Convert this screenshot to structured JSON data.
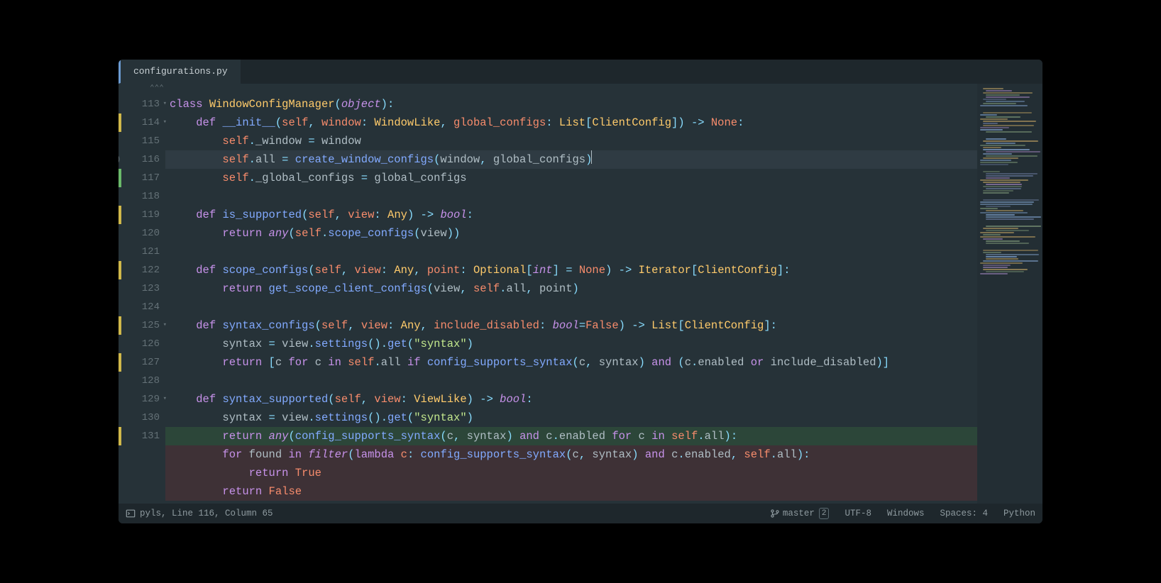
{
  "tab": {
    "filename": "configurations.py"
  },
  "gutter_dots": "⌃⌃⌃",
  "lines": [
    {
      "n": 113,
      "fold": true,
      "mod": "",
      "indent": 0,
      "tokens": [
        [
          "kw",
          "class "
        ],
        [
          "type",
          "WindowConfigManager"
        ],
        [
          "punc",
          "("
        ],
        [
          "kw-i",
          "object"
        ],
        [
          "punc",
          ")"
        ],
        [
          "op",
          ":"
        ]
      ]
    },
    {
      "n": 114,
      "fold": true,
      "mod": "yellow",
      "indent": 1,
      "tokens": [
        [
          "kw",
          "def "
        ],
        [
          "def",
          "__init__"
        ],
        [
          "punc",
          "("
        ],
        [
          "param",
          "self"
        ],
        [
          "punc",
          ", "
        ],
        [
          "param",
          "window"
        ],
        [
          "op",
          ": "
        ],
        [
          "type",
          "WindowLike"
        ],
        [
          "punc",
          ", "
        ],
        [
          "param",
          "global_configs"
        ],
        [
          "op",
          ": "
        ],
        [
          "type",
          "List"
        ],
        [
          "punc",
          "["
        ],
        [
          "type",
          "ClientConfig"
        ],
        [
          "punc",
          "]"
        ],
        [
          "punc",
          ") "
        ],
        [
          "op",
          "-> "
        ],
        [
          "const",
          "None"
        ],
        [
          "op",
          ":"
        ]
      ]
    },
    {
      "n": 115,
      "fold": false,
      "mod": "",
      "indent": 2,
      "tokens": [
        [
          "param",
          "self"
        ],
        [
          "op",
          "."
        ],
        [
          "attr",
          "_window"
        ],
        [
          "op",
          " = "
        ],
        [
          "name",
          "window"
        ]
      ]
    },
    {
      "n": 116,
      "fold": false,
      "mod": "",
      "indent": 2,
      "hl": true,
      "paren": true,
      "cursor": true,
      "tokens": [
        [
          "param",
          "self"
        ],
        [
          "op",
          "."
        ],
        [
          "attr",
          "all"
        ],
        [
          "op",
          " = "
        ],
        [
          "call",
          "create_window_configs"
        ],
        [
          "punc",
          "("
        ],
        [
          "name",
          "window"
        ],
        [
          "punc",
          ", "
        ],
        [
          "name",
          "global_configs"
        ],
        [
          "punc",
          ")"
        ]
      ]
    },
    {
      "n": 117,
      "fold": false,
      "mod": "green",
      "indent": 2,
      "tokens": [
        [
          "param",
          "self"
        ],
        [
          "op",
          "."
        ],
        [
          "attr",
          "_global_configs"
        ],
        [
          "op",
          " = "
        ],
        [
          "name",
          "global_configs"
        ]
      ]
    },
    {
      "n": 118,
      "fold": false,
      "mod": "",
      "indent": 0,
      "tokens": []
    },
    {
      "n": 119,
      "fold": false,
      "mod": "yellow",
      "indent": 1,
      "tokens": [
        [
          "kw",
          "def "
        ],
        [
          "def",
          "is_supported"
        ],
        [
          "punc",
          "("
        ],
        [
          "param",
          "self"
        ],
        [
          "punc",
          ", "
        ],
        [
          "param",
          "view"
        ],
        [
          "op",
          ": "
        ],
        [
          "type",
          "Any"
        ],
        [
          "punc",
          ") "
        ],
        [
          "op",
          "-> "
        ],
        [
          "kw-i",
          "bool"
        ],
        [
          "op",
          ":"
        ]
      ]
    },
    {
      "n": 120,
      "fold": false,
      "mod": "",
      "indent": 2,
      "tokens": [
        [
          "kw",
          "return "
        ],
        [
          "kw-i",
          "any"
        ],
        [
          "punc",
          "("
        ],
        [
          "param",
          "self"
        ],
        [
          "op",
          "."
        ],
        [
          "call",
          "scope_configs"
        ],
        [
          "punc",
          "("
        ],
        [
          "name",
          "view"
        ],
        [
          "punc",
          "))"
        ]
      ]
    },
    {
      "n": 121,
      "fold": false,
      "mod": "",
      "indent": 0,
      "tokens": []
    },
    {
      "n": 122,
      "fold": false,
      "mod": "yellow",
      "indent": 1,
      "tokens": [
        [
          "kw",
          "def "
        ],
        [
          "def",
          "scope_configs"
        ],
        [
          "punc",
          "("
        ],
        [
          "param",
          "self"
        ],
        [
          "punc",
          ", "
        ],
        [
          "param",
          "view"
        ],
        [
          "op",
          ": "
        ],
        [
          "type",
          "Any"
        ],
        [
          "punc",
          ", "
        ],
        [
          "param",
          "point"
        ],
        [
          "op",
          ": "
        ],
        [
          "type",
          "Optional"
        ],
        [
          "punc",
          "["
        ],
        [
          "kw-i",
          "int"
        ],
        [
          "punc",
          "]"
        ],
        [
          "op",
          " = "
        ],
        [
          "const",
          "None"
        ],
        [
          "punc",
          ") "
        ],
        [
          "op",
          "-> "
        ],
        [
          "type",
          "Iterator"
        ],
        [
          "punc",
          "["
        ],
        [
          "type",
          "ClientConfig"
        ],
        [
          "punc",
          "]"
        ],
        [
          "op",
          ":"
        ]
      ]
    },
    {
      "n": 123,
      "fold": false,
      "mod": "",
      "indent": 2,
      "tokens": [
        [
          "kw",
          "return "
        ],
        [
          "call",
          "get_scope_client_configs"
        ],
        [
          "punc",
          "("
        ],
        [
          "name",
          "view"
        ],
        [
          "punc",
          ", "
        ],
        [
          "param",
          "self"
        ],
        [
          "op",
          "."
        ],
        [
          "attr",
          "all"
        ],
        [
          "punc",
          ", "
        ],
        [
          "name",
          "point"
        ],
        [
          "punc",
          ")"
        ]
      ]
    },
    {
      "n": 124,
      "fold": false,
      "mod": "",
      "indent": 0,
      "tokens": []
    },
    {
      "n": 125,
      "fold": true,
      "mod": "yellow",
      "indent": 1,
      "tokens": [
        [
          "kw",
          "def "
        ],
        [
          "def",
          "syntax_configs"
        ],
        [
          "punc",
          "("
        ],
        [
          "param",
          "self"
        ],
        [
          "punc",
          ", "
        ],
        [
          "param",
          "view"
        ],
        [
          "op",
          ": "
        ],
        [
          "type",
          "Any"
        ],
        [
          "punc",
          ", "
        ],
        [
          "param",
          "include_disabled"
        ],
        [
          "op",
          ": "
        ],
        [
          "kw-i",
          "bool"
        ],
        [
          "op",
          "="
        ],
        [
          "const",
          "False"
        ],
        [
          "punc",
          ") "
        ],
        [
          "op",
          "-> "
        ],
        [
          "type",
          "List"
        ],
        [
          "punc",
          "["
        ],
        [
          "type",
          "ClientConfig"
        ],
        [
          "punc",
          "]"
        ],
        [
          "op",
          ":"
        ]
      ]
    },
    {
      "n": 126,
      "fold": false,
      "mod": "",
      "indent": 2,
      "tokens": [
        [
          "name",
          "syntax"
        ],
        [
          "op",
          " = "
        ],
        [
          "name",
          "view"
        ],
        [
          "op",
          "."
        ],
        [
          "call",
          "settings"
        ],
        [
          "punc",
          "()"
        ],
        [
          "op",
          "."
        ],
        [
          "call",
          "get"
        ],
        [
          "punc",
          "("
        ],
        [
          "str",
          "\"syntax\""
        ],
        [
          "punc",
          ")"
        ]
      ]
    },
    {
      "n": 127,
      "fold": false,
      "mod": "yellow",
      "indent": 2,
      "tokens": [
        [
          "kw",
          "return "
        ],
        [
          "punc",
          "["
        ],
        [
          "name",
          "c"
        ],
        [
          "kw",
          " for "
        ],
        [
          "name",
          "c"
        ],
        [
          "kw",
          " in "
        ],
        [
          "param",
          "self"
        ],
        [
          "op",
          "."
        ],
        [
          "attr",
          "all"
        ],
        [
          "kw",
          " if "
        ],
        [
          "call",
          "config_supports_syntax"
        ],
        [
          "punc",
          "("
        ],
        [
          "name",
          "c"
        ],
        [
          "punc",
          ", "
        ],
        [
          "name",
          "syntax"
        ],
        [
          "punc",
          ") "
        ],
        [
          "kw",
          "and "
        ],
        [
          "punc",
          "("
        ],
        [
          "name",
          "c"
        ],
        [
          "op",
          "."
        ],
        [
          "attr",
          "enabled"
        ],
        [
          "kw",
          " or "
        ],
        [
          "name",
          "include_disabled"
        ],
        [
          "punc",
          ")]"
        ]
      ]
    },
    {
      "n": 128,
      "fold": false,
      "mod": "",
      "indent": 0,
      "tokens": []
    },
    {
      "n": 129,
      "fold": true,
      "mod": "",
      "indent": 1,
      "tokens": [
        [
          "kw",
          "def "
        ],
        [
          "def",
          "syntax_supported"
        ],
        [
          "punc",
          "("
        ],
        [
          "param",
          "self"
        ],
        [
          "punc",
          ", "
        ],
        [
          "param",
          "view"
        ],
        [
          "op",
          ": "
        ],
        [
          "type",
          "ViewLike"
        ],
        [
          "punc",
          ") "
        ],
        [
          "op",
          "-> "
        ],
        [
          "kw-i",
          "bool"
        ],
        [
          "op",
          ":"
        ]
      ]
    },
    {
      "n": 130,
      "fold": false,
      "mod": "",
      "indent": 2,
      "tokens": [
        [
          "name",
          "syntax"
        ],
        [
          "op",
          " = "
        ],
        [
          "name",
          "view"
        ],
        [
          "op",
          "."
        ],
        [
          "call",
          "settings"
        ],
        [
          "punc",
          "()"
        ],
        [
          "op",
          "."
        ],
        [
          "call",
          "get"
        ],
        [
          "punc",
          "("
        ],
        [
          "str",
          "\"syntax\""
        ],
        [
          "punc",
          ")"
        ]
      ]
    },
    {
      "n": 131,
      "fold": false,
      "mod": "yellow",
      "indent": 2,
      "diff": "add",
      "tokens": [
        [
          "kw",
          "return "
        ],
        [
          "kw-i",
          "any"
        ],
        [
          "punc",
          "("
        ],
        [
          "call",
          "config_supports_syntax"
        ],
        [
          "punc",
          "("
        ],
        [
          "name",
          "c"
        ],
        [
          "punc",
          ", "
        ],
        [
          "name",
          "syntax"
        ],
        [
          "punc",
          ") "
        ],
        [
          "kw",
          "and "
        ],
        [
          "name",
          "c"
        ],
        [
          "op",
          "."
        ],
        [
          "attr",
          "enabled"
        ],
        [
          "kw",
          " for "
        ],
        [
          "name",
          "c"
        ],
        [
          "kw",
          " in "
        ],
        [
          "param",
          "self"
        ],
        [
          "op",
          "."
        ],
        [
          "attr",
          "all"
        ],
        [
          "punc",
          "):"
        ]
      ]
    },
    {
      "n": "",
      "fold": false,
      "mod": "",
      "indent": 2,
      "diff": "del",
      "tokens": [
        [
          "kw",
          "for "
        ],
        [
          "name",
          "found"
        ],
        [
          "kw",
          " in "
        ],
        [
          "kw-i",
          "filter"
        ],
        [
          "punc",
          "("
        ],
        [
          "kw",
          "lambda "
        ],
        [
          "param",
          "c"
        ],
        [
          "op",
          ": "
        ],
        [
          "call",
          "config_supports_syntax"
        ],
        [
          "punc",
          "("
        ],
        [
          "name",
          "c"
        ],
        [
          "punc",
          ", "
        ],
        [
          "name",
          "syntax"
        ],
        [
          "punc",
          ") "
        ],
        [
          "kw",
          "and "
        ],
        [
          "name",
          "c"
        ],
        [
          "op",
          "."
        ],
        [
          "attr",
          "enabled"
        ],
        [
          "punc",
          ", "
        ],
        [
          "param",
          "self"
        ],
        [
          "op",
          "."
        ],
        [
          "attr",
          "all"
        ],
        [
          "punc",
          "):"
        ]
      ]
    },
    {
      "n": "",
      "fold": false,
      "mod": "",
      "indent": 3,
      "diff": "del",
      "tokens": [
        [
          "kw",
          "return "
        ],
        [
          "const",
          "True"
        ]
      ]
    },
    {
      "n": "",
      "fold": false,
      "mod": "",
      "indent": 2,
      "diff": "del",
      "tokens": [
        [
          "kw",
          "return "
        ],
        [
          "const",
          "False"
        ]
      ]
    }
  ],
  "status": {
    "left": "pyls, Line 116, Column 65",
    "branch": "master",
    "branch_key": "2",
    "encoding": "UTF-8",
    "line_endings": "Windows",
    "indentation": "Spaces: 4",
    "language": "Python"
  }
}
